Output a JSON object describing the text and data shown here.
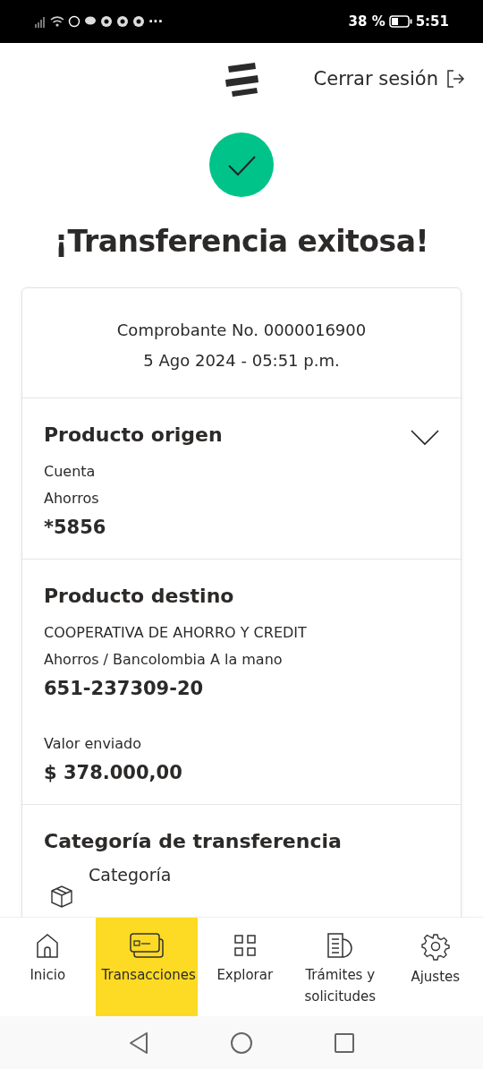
{
  "status_bar": {
    "battery_text": "38 %",
    "time": "5:51",
    "overflow": "···"
  },
  "header": {
    "logout": "Cerrar sesión"
  },
  "title": "¡Transferencia exitosa!",
  "receipt": {
    "number": "Comprobante No. 0000016900",
    "datetime": "5 Ago 2024 - 05:51 p.m."
  },
  "origin": {
    "heading": "Producto origen",
    "type": "Cuenta",
    "subtype": "Ahorros",
    "account": "*5856"
  },
  "destination": {
    "heading": "Producto destino",
    "bank": "COOPERATIVA DE AHORRO Y CREDIT",
    "type": "Ahorros / Bancolombia A la mano",
    "account": "651-237309-20",
    "amount_label": "Valor enviado",
    "amount": "$ 378.000,00"
  },
  "category": {
    "heading": "Categoría de transferencia",
    "label": "Categoría"
  },
  "nav": [
    {
      "kind": "home",
      "label": "Inicio",
      "selected": false
    },
    {
      "kind": "cards",
      "label": "Transacciones",
      "selected": true
    },
    {
      "kind": "grid",
      "label": "Explorar",
      "selected": false
    },
    {
      "kind": "docs",
      "label": "Trámites y solicitudes",
      "selected": false
    },
    {
      "kind": "gear",
      "label": "Ajustes",
      "selected": false
    }
  ]
}
